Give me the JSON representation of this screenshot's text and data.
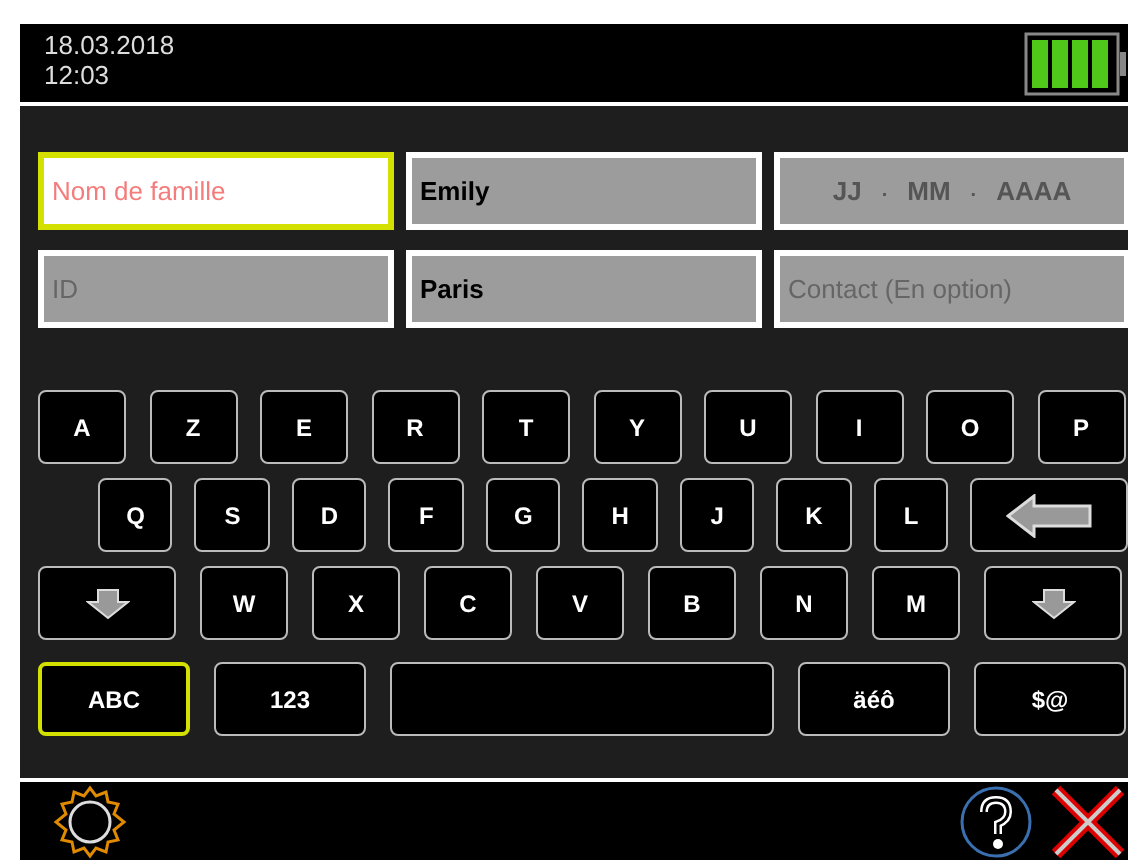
{
  "status_bar": {
    "date": "18.03.2018",
    "time": "12:03"
  },
  "fields": [
    {
      "kind": "text",
      "placeholder": "Nom de famille",
      "focused": true
    },
    {
      "kind": "text",
      "value": "Emily",
      "focused": false
    },
    {
      "kind": "date",
      "parts": [
        "JJ",
        "MM",
        "AAAA"
      ],
      "separators": [
        ".",
        "."
      ],
      "focused": false
    },
    {
      "kind": "text",
      "placeholder": "ID",
      "focused": false
    },
    {
      "kind": "text",
      "value": "Paris",
      "focused": false
    },
    {
      "kind": "text",
      "placeholder": "Contact (En option)",
      "focused": false
    }
  ],
  "keyboard": {
    "rows": [
      [
        {
          "kind": "letter",
          "label": "A"
        },
        {
          "kind": "letter",
          "label": "Z"
        },
        {
          "kind": "letter",
          "label": "E"
        },
        {
          "kind": "letter",
          "label": "R"
        },
        {
          "kind": "letter",
          "label": "T"
        },
        {
          "kind": "letter",
          "label": "Y"
        },
        {
          "kind": "letter",
          "label": "U"
        },
        {
          "kind": "letter",
          "label": "I"
        },
        {
          "kind": "letter",
          "label": "O"
        },
        {
          "kind": "letter",
          "label": "P"
        }
      ],
      [
        {
          "kind": "letter",
          "label": "Q"
        },
        {
          "kind": "letter",
          "label": "S"
        },
        {
          "kind": "letter",
          "label": "D"
        },
        {
          "kind": "letter",
          "label": "F"
        },
        {
          "kind": "letter",
          "label": "G"
        },
        {
          "kind": "letter",
          "label": "H"
        },
        {
          "kind": "letter",
          "label": "J"
        },
        {
          "kind": "letter",
          "label": "K"
        },
        {
          "kind": "letter",
          "label": "L"
        },
        {
          "kind": "backspace"
        }
      ],
      [
        {
          "kind": "shift"
        },
        {
          "kind": "letter",
          "label": "W"
        },
        {
          "kind": "letter",
          "label": "X"
        },
        {
          "kind": "letter",
          "label": "C"
        },
        {
          "kind": "letter",
          "label": "V"
        },
        {
          "kind": "letter",
          "label": "B"
        },
        {
          "kind": "letter",
          "label": "N"
        },
        {
          "kind": "letter",
          "label": "M"
        },
        {
          "kind": "shift"
        }
      ]
    ],
    "modes": [
      {
        "kind": "mode",
        "label": "ABC",
        "selected": true
      },
      {
        "kind": "mode",
        "label": "123",
        "selected": false
      },
      {
        "kind": "space"
      },
      {
        "kind": "mode",
        "label": "äéô",
        "selected": false
      },
      {
        "kind": "mode",
        "label": "$@",
        "selected": false
      }
    ]
  }
}
